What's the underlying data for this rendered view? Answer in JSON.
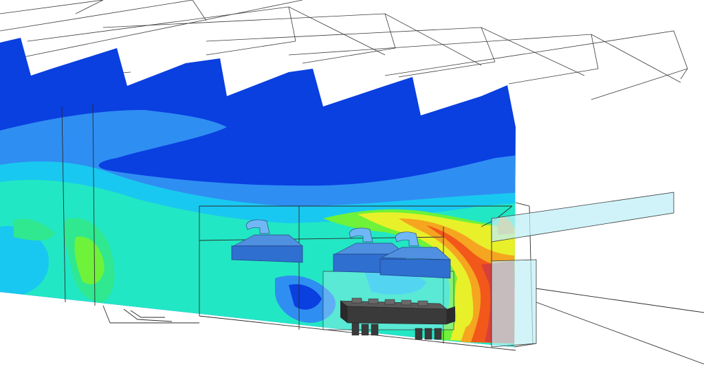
{
  "scene": {
    "type": "3d-cfd-contour-render",
    "subject": "sawtooth-roof-building-cross-section",
    "colormap": [
      "#0a3fe0",
      "#2f8ef2",
      "#19c8f0",
      "#22e7c4",
      "#2fe88f",
      "#6ef23a",
      "#e8f02a",
      "#f5a520",
      "#f2581a",
      "#d6403a"
    ],
    "background": "#ffffff",
    "wireframe_color": "#3a3a3a",
    "equipment": {
      "hood_color": "#2f6fd0",
      "duct_color": "#6fb8f5",
      "machine_color": "#3a3a3a",
      "transparent_box_color": "#bfeff5"
    }
  }
}
